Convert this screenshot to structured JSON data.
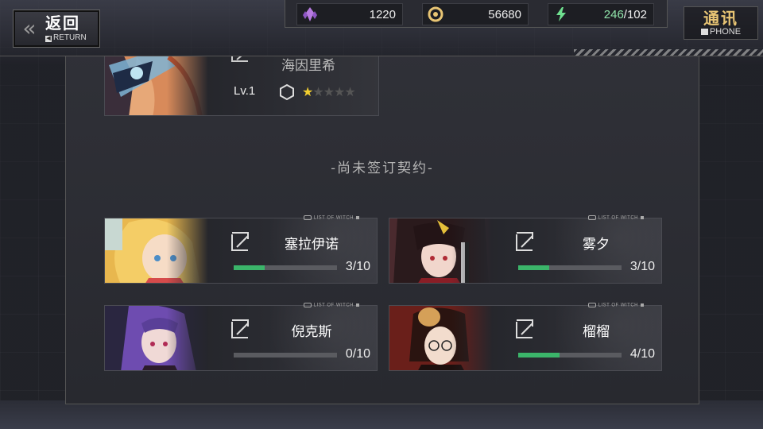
{
  "header": {
    "back": {
      "cn": "返回",
      "en": "RETURN"
    },
    "resources": [
      {
        "icon": "crystal-icon",
        "value": "1220",
        "color": "#c58be8"
      },
      {
        "icon": "gold-coin-icon",
        "value": "56680",
        "color": "#e8c574"
      },
      {
        "icon": "stamina-bolt-icon",
        "current": "246",
        "max": "/102",
        "color": "#6fe08f"
      }
    ],
    "phone": {
      "cn": "通讯",
      "en": "PHONE"
    }
  },
  "top_card": {
    "name_partial": "海因里希",
    "level": "Lv.1",
    "stars_filled": 1,
    "stars_total": 5
  },
  "section_label": "-尚未签订契约-",
  "cards": [
    {
      "name": "塞拉伊诺",
      "progress": "3/10",
      "fraction": 0.3,
      "tag": "LIST OF WITCH"
    },
    {
      "name": "雾夕",
      "progress": "3/10",
      "fraction": 0.3,
      "tag": "LIST OF WITCH"
    },
    {
      "name": "倪克斯",
      "progress": "0/10",
      "fraction": 0.0,
      "tag": "LIST OF WITCH"
    },
    {
      "name": "榴榴",
      "progress": "4/10",
      "fraction": 0.4,
      "tag": "LIST OF WITCH"
    }
  ]
}
